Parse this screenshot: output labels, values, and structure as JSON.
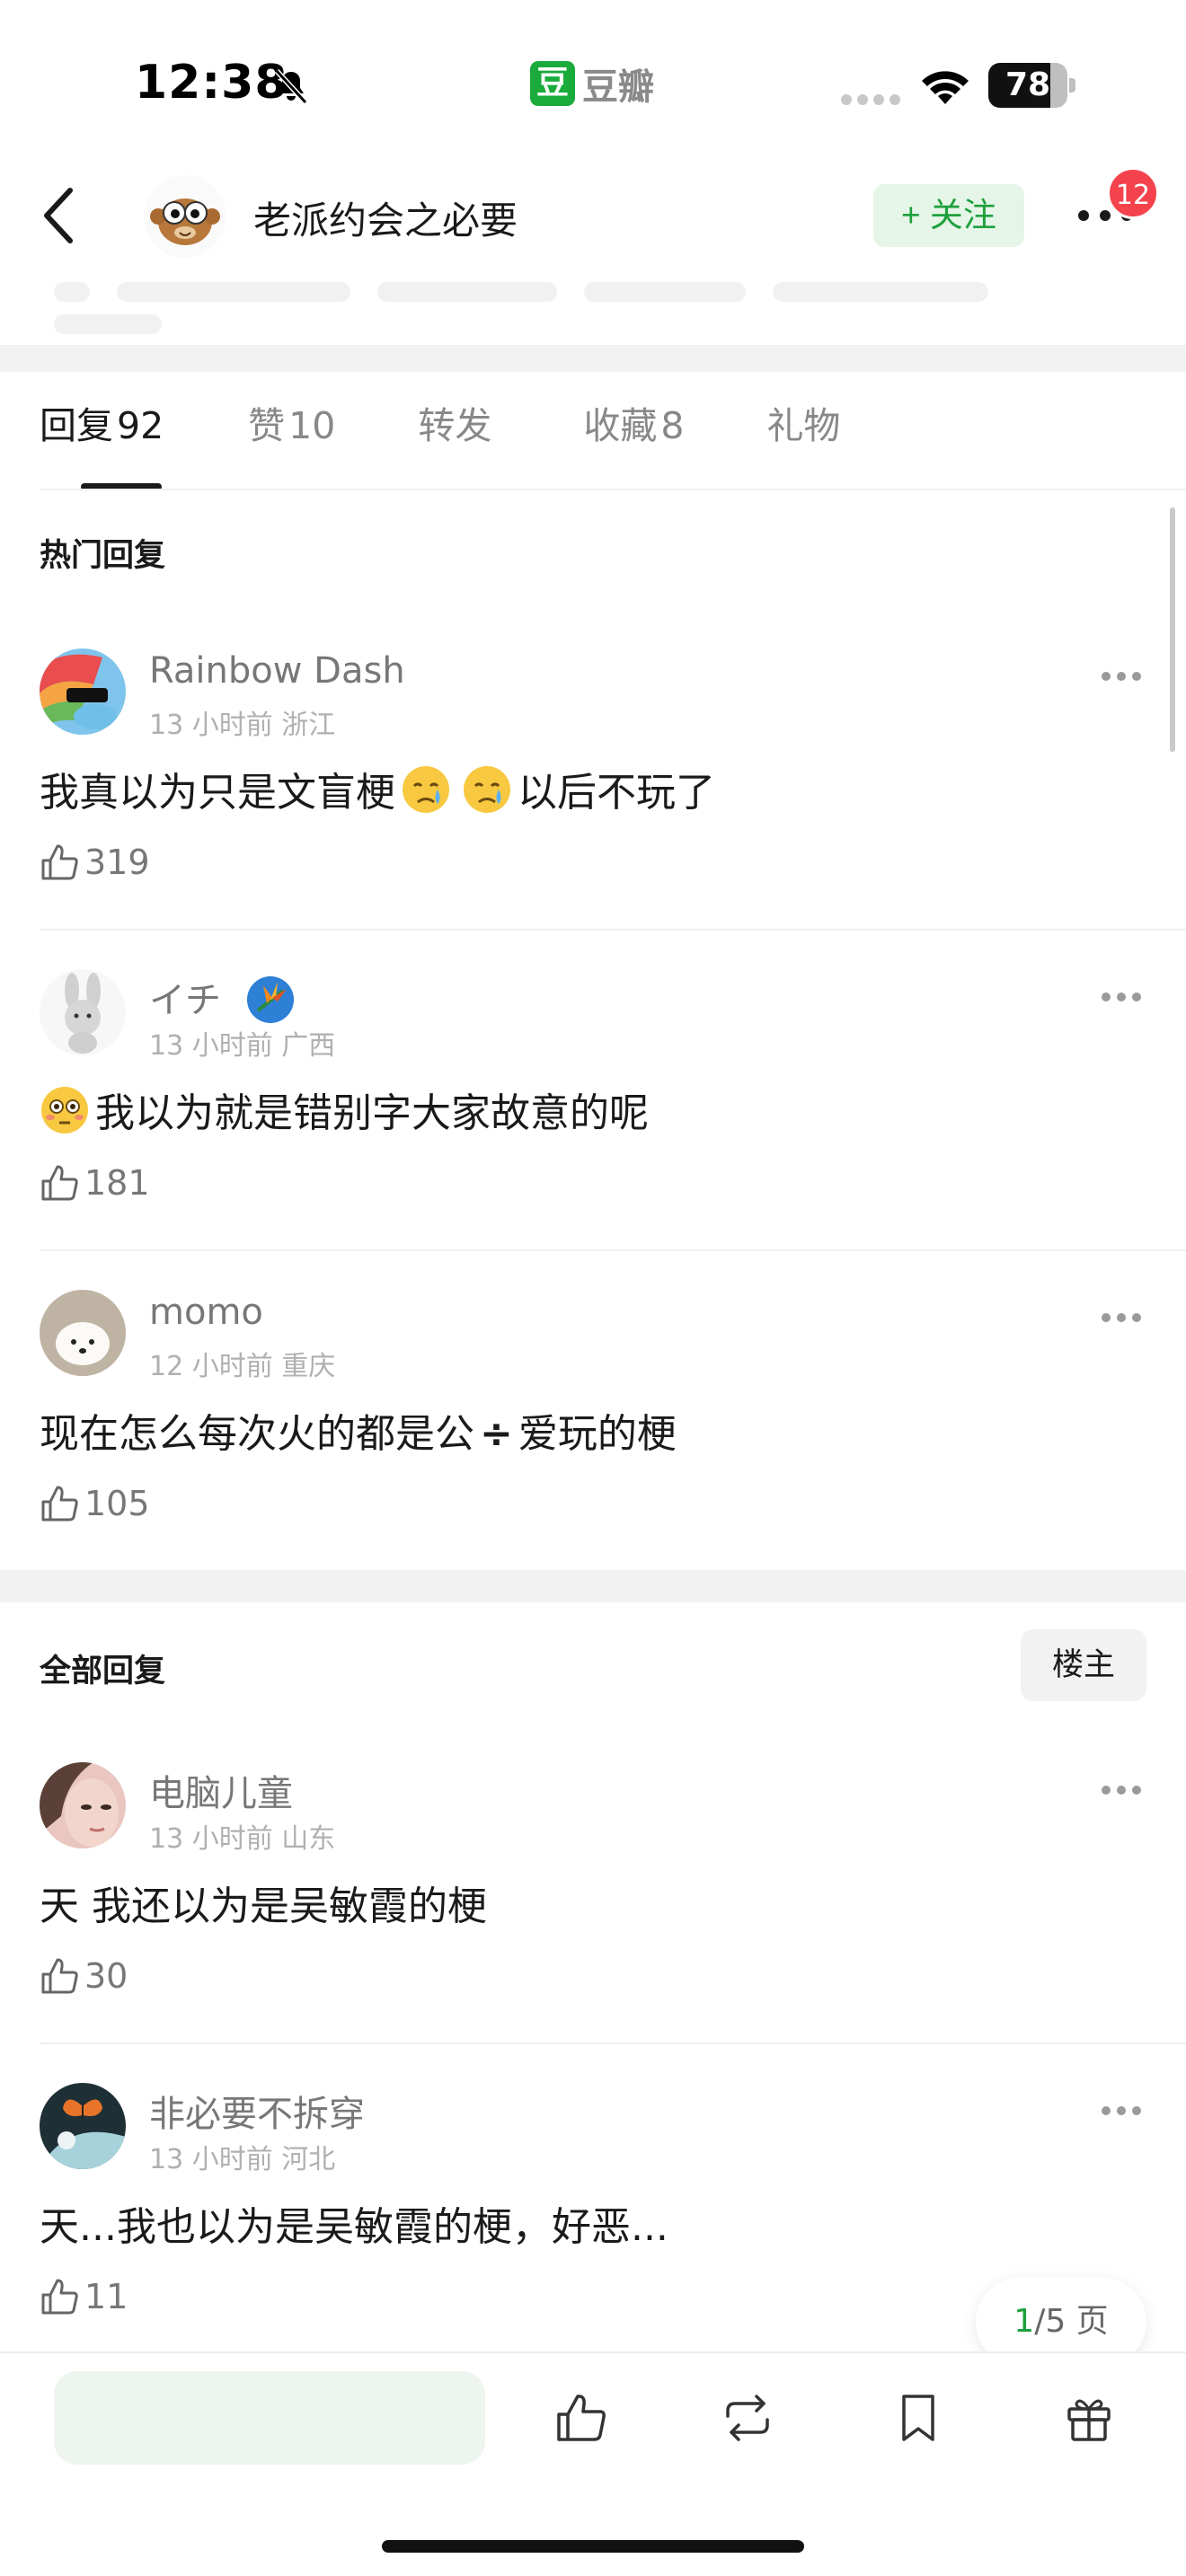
{
  "status_bar": {
    "time": "12:38",
    "app_name": "豆瓣",
    "app_logo_char": "豆",
    "battery": "78",
    "battery_level_percent": 78
  },
  "header": {
    "title": "老派约会之必要",
    "follow_label": "+ 关注",
    "notification_count": "12"
  },
  "tabs": [
    {
      "label": "回复",
      "count": "92",
      "active": true
    },
    {
      "label": "赞",
      "count": "10",
      "active": false
    },
    {
      "label": "转发",
      "count": "",
      "active": false
    },
    {
      "label": "收藏",
      "count": "8",
      "active": false
    },
    {
      "label": "礼物",
      "count": "",
      "active": false
    }
  ],
  "hot_section": {
    "title": "热门回复",
    "comments": [
      {
        "name": "Rainbow Dash",
        "meta": "13 小时前 浙江",
        "text_a": "我真以为只是文盲梗",
        "text_b": "以后不玩了",
        "likes": "319"
      },
      {
        "name": "イチ",
        "meta": "13 小时前 广西",
        "text": "我以为就是错别字大家故意的呢",
        "likes": "181"
      },
      {
        "name": "momo",
        "meta": "12 小时前 重庆",
        "text_a": "现在怎么每次火的都是公",
        "symbol": "÷",
        "text_b": "爱玩的梗",
        "likes": "105"
      }
    ]
  },
  "all_section": {
    "title": "全部回复",
    "owner_label": "楼主",
    "comments": [
      {
        "name": "电脑儿童",
        "meta": "13 小时前 山东",
        "text": "天 我还以为是吴敏霞的梗",
        "likes": "30"
      },
      {
        "name": "非必要不拆穿",
        "meta": "13 小时前 河北",
        "text": "天...我也以为是吴敏霞的梗，好恶...",
        "likes": "11"
      }
    ]
  },
  "pagination": {
    "current": "1",
    "rest": "/5 页"
  },
  "bottom_bar": {
    "icons": [
      "like-icon",
      "repost-icon",
      "bookmark-icon",
      "gift-icon"
    ]
  },
  "colors": {
    "accent_green": "#1ea03c",
    "follow_bg": "#e5f6e8",
    "badge_red": "#f4434d",
    "input_bg": "#eef5ef"
  }
}
